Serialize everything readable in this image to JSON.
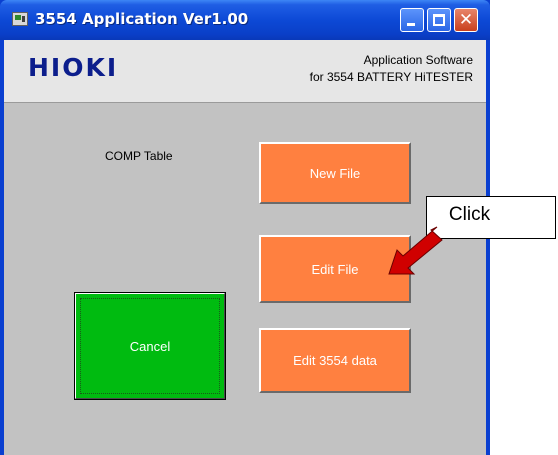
{
  "window": {
    "title": "3554 Application   Ver1.00",
    "minimize_icon": "minimize-icon",
    "maximize_icon": "maximize-icon",
    "close_icon": "close-icon",
    "close_glyph": "✕",
    "colors": {
      "titlebar": "#0d49d6",
      "client_bg": "#c2c2c2",
      "header_bg": "#e6e6e6"
    }
  },
  "header": {
    "logo": "HIOKI",
    "line1": "Application Software",
    "line2": "for 3554 BATTERY HiTESTER",
    "logo_color": "#0c1e8c"
  },
  "main": {
    "comp_table_label": "COMP Table",
    "buttons": {
      "new_file": "New File",
      "edit_file": "Edit File",
      "edit_3554_data": "Edit 3554 data",
      "cancel": "Cancel"
    },
    "button_colors": {
      "orange": "#ff8040",
      "green": "#00bb10"
    }
  },
  "annotation": {
    "callout_text": "Click",
    "arrow_icon": "arrow-icon",
    "arrow_color": "#d00000"
  }
}
